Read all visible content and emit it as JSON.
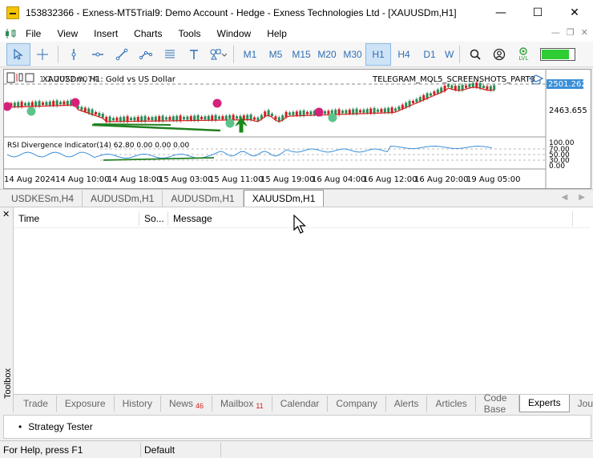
{
  "window": {
    "title": "153832366 - Exness-MT5Trial9: Demo Account - Hedge - Exness Technologies Ltd - [XAUUSDm,H1]",
    "minimize": "—",
    "maximize": "☐",
    "close": "✕"
  },
  "menu": {
    "items": [
      "File",
      "View",
      "Insert",
      "Charts",
      "Tools",
      "Window",
      "Help"
    ]
  },
  "toolbar": {
    "timeframes": [
      "M1",
      "M5",
      "M15",
      "M20",
      "M30",
      "H1",
      "H4",
      "D1",
      "W"
    ],
    "active_timeframe": "H1",
    "algo_level": 0.85,
    "lvl_label": "LVL"
  },
  "chart": {
    "symbol_line": "XAUUSDm, H1:  Gold vs US Dollar",
    "overlay_garble": "1.1.2022.0074",
    "script_label": "TELEGRAM_MQL5_SCREENSHOTS_PART3",
    "current_price": "2501.262",
    "price_level_2": "2463.655",
    "indicator_label": "RSI Divergence Indicator(14) 62.80 0.00 0.00 0.00",
    "rsi_levels": [
      "100.00",
      "70.00",
      "50.00",
      "30.00",
      "0.00"
    ],
    "time_labels": [
      "14 Aug 2024",
      "14 Aug 10:00",
      "14 Aug 18:00",
      "15 Aug 03:00",
      "15 Aug 11:00",
      "15 Aug 19:00",
      "16 Aug 04:00",
      "16 Aug 12:00",
      "16 Aug 20:00",
      "19 Aug 05:00"
    ],
    "colors": {
      "bull": "#2e8b57",
      "bear": "#d02020",
      "ma": "#d02020",
      "rsi": "#3a8fd9",
      "div_line": "#208020",
      "magenta": "#d6217a",
      "green_dot": "#5cc48a"
    }
  },
  "chart_tabs": {
    "items": [
      "USDKESm,H4",
      "AUDUSDm,H1",
      "AUDUSDm,H1",
      "XAUUSDm,H1"
    ],
    "active": 3
  },
  "toolbox": {
    "side_label": "Toolbox",
    "columns": [
      "Time",
      "So...",
      "Message"
    ],
    "tabs": [
      {
        "label": "Trade",
        "badge": ""
      },
      {
        "label": "Exposure",
        "badge": ""
      },
      {
        "label": "History",
        "badge": ""
      },
      {
        "label": "News",
        "badge": "46"
      },
      {
        "label": "Mailbox",
        "badge": "11"
      },
      {
        "label": "Calendar",
        "badge": ""
      },
      {
        "label": "Company",
        "badge": ""
      },
      {
        "label": "Alerts",
        "badge": ""
      },
      {
        "label": "Articles",
        "badge": ""
      },
      {
        "label": "Code Base",
        "badge": ""
      },
      {
        "label": "Experts",
        "badge": ""
      },
      {
        "label": "Jou",
        "badge": ""
      }
    ],
    "active_tab": 10
  },
  "strategy_tester": {
    "label": "Strategy Tester"
  },
  "status": {
    "help": "For Help, press F1",
    "profile": "Default"
  }
}
